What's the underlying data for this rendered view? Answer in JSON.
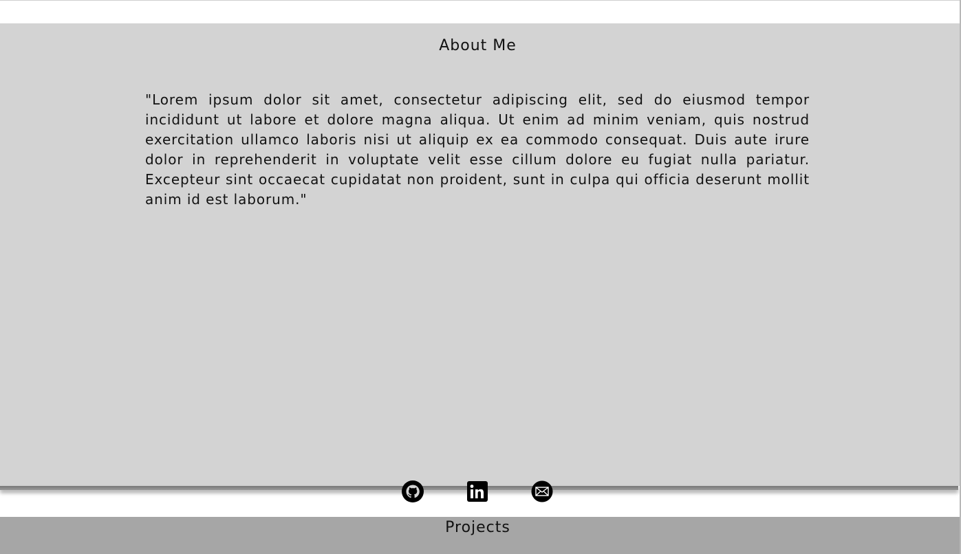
{
  "about": {
    "title": "About Me",
    "text": "\"Lorem ipsum dolor sit amet, consectetur adipiscing elit, sed do eiusmod tempor incididunt ut labore et dolore magna aliqua. Ut enim ad minim veniam, quis nostrud exercitation ullamco laboris nisi ut aliquip ex ea commodo consequat. Duis aute irure dolor in reprehenderit in voluptate velit esse cillum dolore eu fugiat nulla pariatur. Excepteur sint occaecat cupidatat non proident, sunt in culpa qui officia deserunt mollit anim id est laborum.\""
  },
  "social": {
    "links": [
      {
        "icon": "github-icon"
      },
      {
        "icon": "linkedin-icon"
      },
      {
        "icon": "email-icon"
      }
    ]
  },
  "projects": {
    "title": "Projects"
  },
  "colors": {
    "about_background": "#d3d3d3",
    "projects_background": "#a6a6a6",
    "text": "#111111"
  }
}
